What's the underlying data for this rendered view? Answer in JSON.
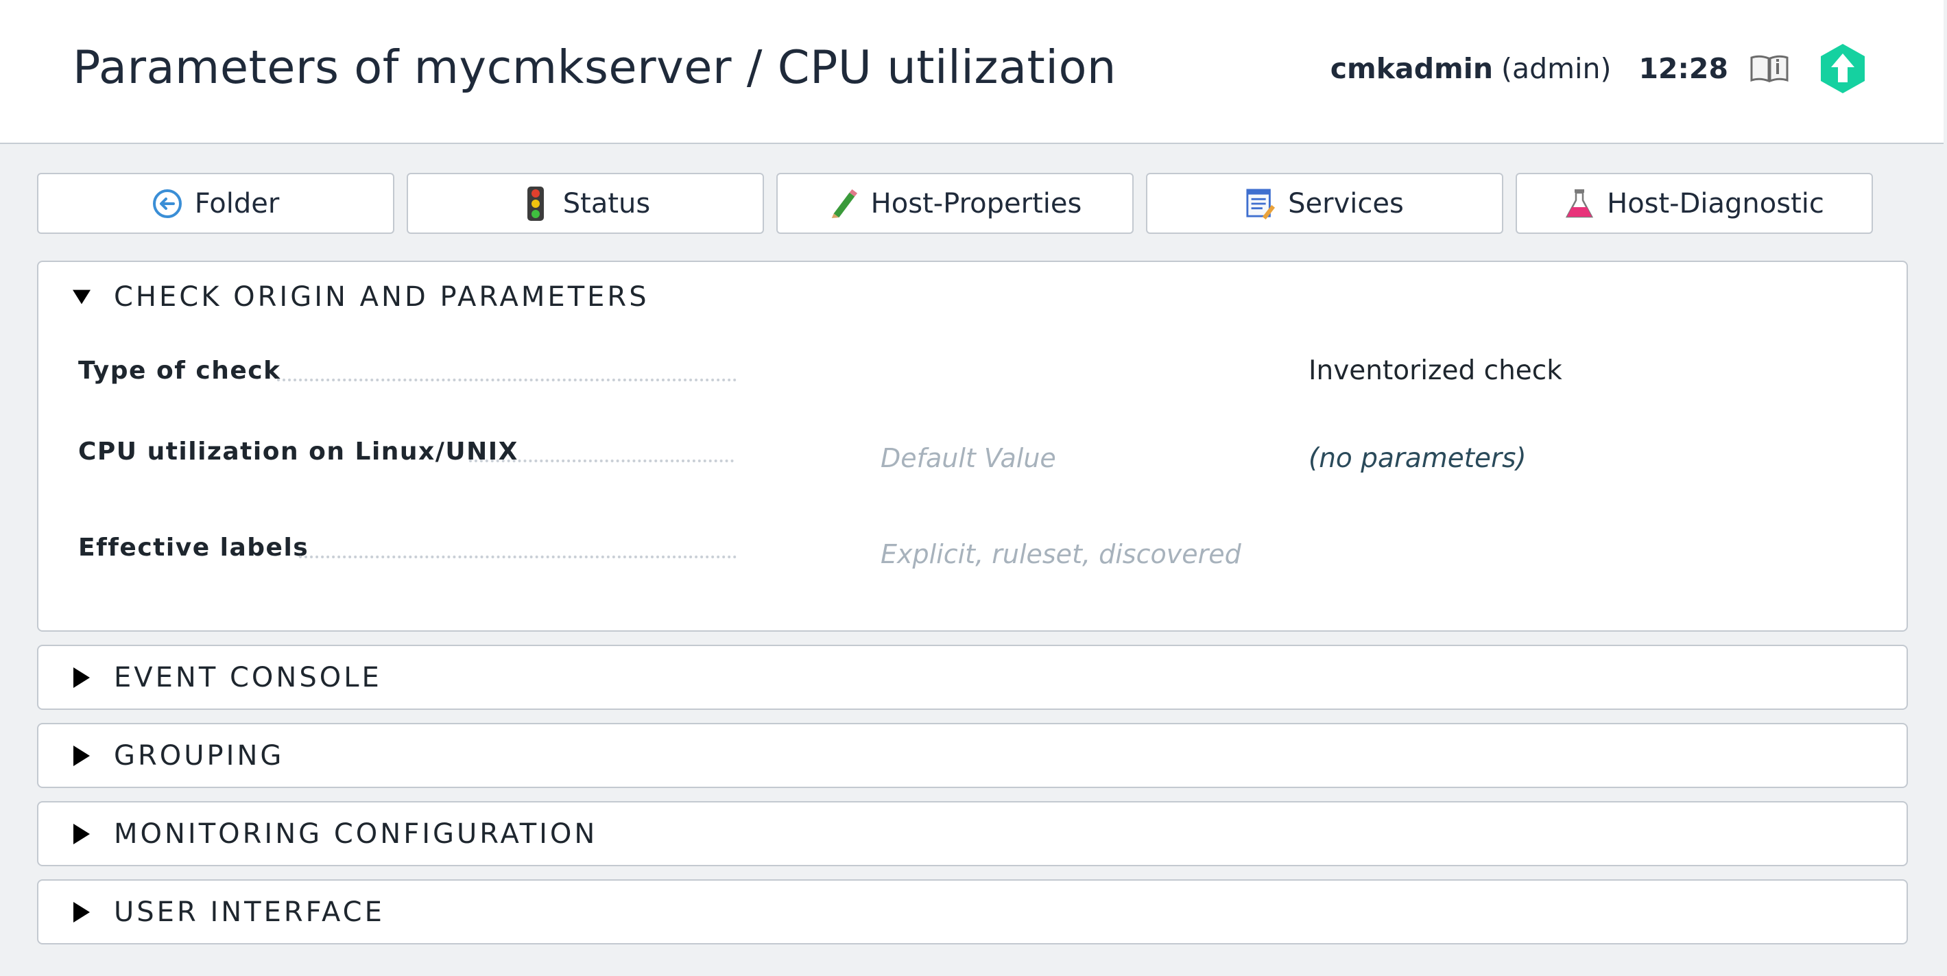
{
  "header": {
    "title": "Parameters of mycmkserver / CPU utilization",
    "username": "cmkadmin",
    "role": "(admin)",
    "time": "12:28",
    "help_icon": "book-icon",
    "logo_icon": "checkmk-logo-icon",
    "logo_color": "#15d1a0"
  },
  "nav": {
    "buttons": [
      {
        "label": "Folder",
        "icon": "back-arrow-icon"
      },
      {
        "label": "Status",
        "icon": "traffic-light-icon"
      },
      {
        "label": "Host-Properties",
        "icon": "pencil-icon"
      },
      {
        "label": "Services",
        "icon": "services-list-icon"
      },
      {
        "label": "Host-Diagnostic",
        "icon": "flask-icon"
      }
    ]
  },
  "sections": {
    "check_origin": {
      "title": "CHECK ORIGIN AND PARAMETERS",
      "expanded": true,
      "rows": [
        {
          "label": "Type of check",
          "default": "",
          "value": "Inventorized check"
        },
        {
          "label": "CPU utilization on Linux/UNIX",
          "default": "Default Value",
          "value": "(no parameters)"
        },
        {
          "label": "Effective labels",
          "default": "Explicit, ruleset, discovered",
          "value": ""
        }
      ]
    },
    "event_console": {
      "title": "EVENT CONSOLE",
      "expanded": false
    },
    "grouping": {
      "title": "GROUPING",
      "expanded": false
    },
    "monitoring_configuration": {
      "title": "MONITORING CONFIGURATION",
      "expanded": false
    },
    "user_interface": {
      "title": "USER INTERFACE",
      "expanded": false
    }
  }
}
